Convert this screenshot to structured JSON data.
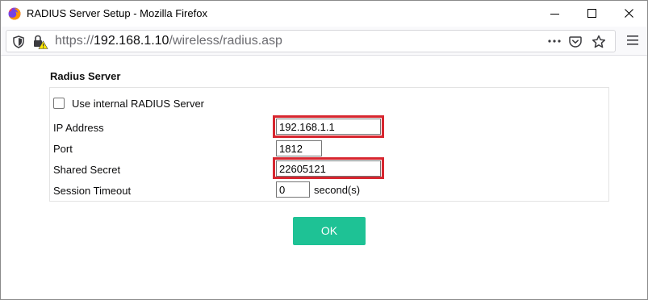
{
  "window": {
    "title": "RADIUS Server Setup - Mozilla Firefox"
  },
  "browser": {
    "url_scheme": "https://",
    "url_host": "192.168.1.10",
    "url_path": "/wireless/radius.asp"
  },
  "form": {
    "section_title": "Radius Server",
    "use_internal_label": "Use internal RADIUS Server",
    "use_internal_checked": false,
    "ip_label": "IP Address",
    "ip_value": "192.168.1.1",
    "port_label": "Port",
    "port_value": "1812",
    "secret_label": "Shared Secret",
    "secret_value": "22605121",
    "timeout_label": "Session Timeout",
    "timeout_value": "0",
    "timeout_unit": "second(s)",
    "ok_label": "OK"
  },
  "colors": {
    "ok_button": "#1ec295",
    "highlight": "#d7262f"
  }
}
